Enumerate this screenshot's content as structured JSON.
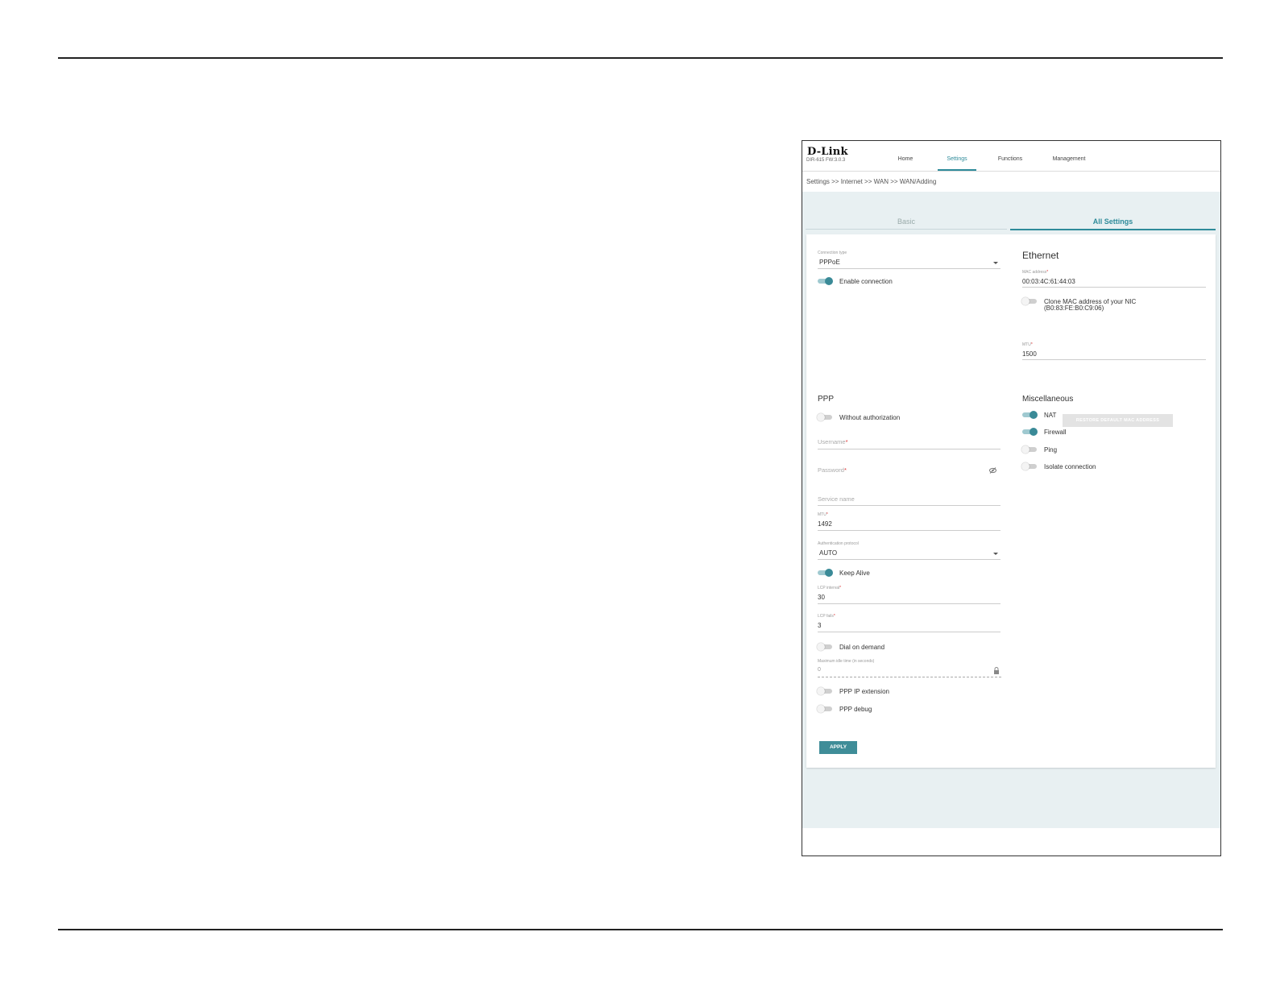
{
  "header": {
    "logo": "D-Link",
    "model": "DIR-615 FW:3.0.3",
    "nav": [
      "Home",
      "Settings",
      "Functions",
      "Management"
    ],
    "active_nav": "Settings"
  },
  "breadcrumb": "Settings >> Internet >> WAN >> WAN/Adding",
  "tabs": {
    "basic": "Basic",
    "all": "All Settings"
  },
  "connection": {
    "type_label": "Connection type",
    "type_value": "PPPoE",
    "enable_label": "Enable connection",
    "enable_on": true
  },
  "ethernet": {
    "title": "Ethernet",
    "mac_label": "MAC address",
    "mac_value": "00:03:4C:61:44:03",
    "clone_label": "Clone MAC address of your NIC",
    "clone_mac": "(B0:83:FE:B0:C9:06)",
    "restore_button": "RESTORE DEFAULT MAC ADDRESS",
    "mtu_label": "MTU",
    "mtu_value": "1500"
  },
  "ppp": {
    "title": "PPP",
    "without_auth": "Without authorization",
    "username": "Username",
    "password": "Password",
    "service_name": "Service name",
    "mtu_label": "MTU",
    "mtu_value": "1492",
    "auth_label": "Authentication protocol",
    "auth_value": "AUTO",
    "keep_alive": "Keep Alive",
    "lcp_interval_label": "LCP interval",
    "lcp_interval_value": "30",
    "lcp_fails_label": "LCP fails",
    "lcp_fails_value": "3",
    "dial_on_demand": "Dial on demand",
    "max_idle_label": "Maximum idle time (in seconds)",
    "max_idle_value": "0",
    "ip_extension": "PPP IP extension",
    "debug": "PPP debug"
  },
  "misc": {
    "title": "Miscellaneous",
    "nat": "NAT",
    "firewall": "Firewall",
    "ping": "Ping",
    "isolate": "Isolate connection"
  },
  "apply_button": "APPLY",
  "colors": {
    "accent": "#3a8a97",
    "required": "#d33333"
  }
}
